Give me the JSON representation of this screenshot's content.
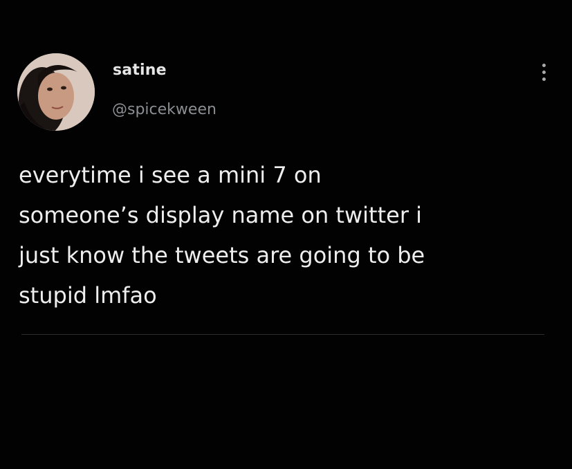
{
  "tweet": {
    "author": {
      "display_name": "satine",
      "handle": "@spicekween",
      "avatar_icon": "profile-photo"
    },
    "more_menu_icon": "vertical-ellipsis-icon",
    "text": "everytime i see a mini 7 on\nsomeone’s display name on twitter i\njust know the tweets are going to be\nstupid lmfao"
  },
  "colors": {
    "background": "#000000",
    "text": "#eeeeee",
    "handle": "#8b8f93"
  }
}
